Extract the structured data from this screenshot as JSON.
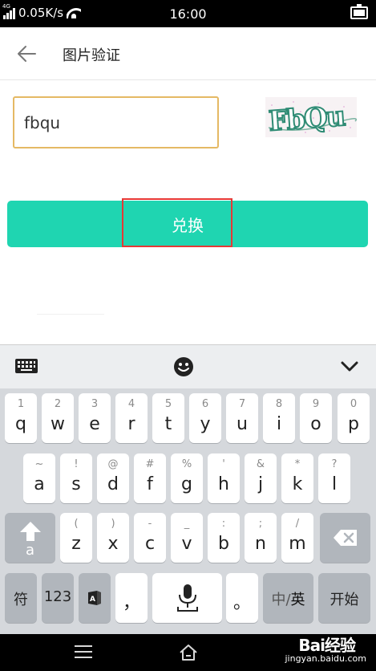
{
  "status_bar": {
    "network_type": "4G",
    "speed": "0.05K/s",
    "time": "16:00"
  },
  "app_bar": {
    "title": "图片验证"
  },
  "form": {
    "code_value": "fbqu",
    "captcha_text": "FbQu",
    "submit_label": "兑换"
  },
  "keyboard": {
    "row1": [
      {
        "sub": "1",
        "main": "q"
      },
      {
        "sub": "2",
        "main": "w"
      },
      {
        "sub": "3",
        "main": "e"
      },
      {
        "sub": "4",
        "main": "r"
      },
      {
        "sub": "5",
        "main": "t"
      },
      {
        "sub": "6",
        "main": "y"
      },
      {
        "sub": "7",
        "main": "u"
      },
      {
        "sub": "8",
        "main": "i"
      },
      {
        "sub": "9",
        "main": "o"
      },
      {
        "sub": "0",
        "main": "p"
      }
    ],
    "row2": [
      {
        "sub": "~",
        "main": "a"
      },
      {
        "sub": "!",
        "main": "s"
      },
      {
        "sub": "@",
        "main": "d"
      },
      {
        "sub": "#",
        "main": "f"
      },
      {
        "sub": "%",
        "main": "g"
      },
      {
        "sub": "'",
        "main": "h"
      },
      {
        "sub": "&",
        "main": "j"
      },
      {
        "sub": "*",
        "main": "k"
      },
      {
        "sub": "?",
        "main": "l"
      }
    ],
    "row3": [
      {
        "sub": "(",
        "main": "z"
      },
      {
        "sub": ")",
        "main": "x"
      },
      {
        "sub": "-",
        "main": "c"
      },
      {
        "sub": "_",
        "main": "v"
      },
      {
        "sub": ":",
        "main": "b"
      },
      {
        "sub": ";",
        "main": "n"
      },
      {
        "sub": "/",
        "main": "m"
      }
    ],
    "shift_letter": "a",
    "symbol_label": "符",
    "number_label": "123",
    "comma_label": "，",
    "period_label": "。",
    "lang_label_prefix": "中/",
    "lang_label_active": "英",
    "enter_label": "开始"
  },
  "watermark": {
    "brand": "Bai经验",
    "url": "jingyan.baidu.com"
  }
}
